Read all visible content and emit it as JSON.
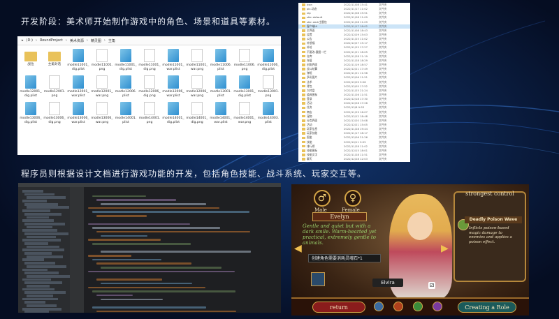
{
  "caption_top": "开发阶段：美术师开始制作游戏中的角色、场景和道具等素材。",
  "caption_mid": "程序员则根据设计文档进行游戏功能的开发，包括角色技能、战斗系统、玩家交互等。",
  "explorer": {
    "breadcrumb": [
      "(D:)",
      "RoundProject",
      "美术资源",
      "精灵图",
      "主角"
    ],
    "files": [
      {
        "name": "战位",
        "kind": "folder"
      },
      {
        "name": "主角对话",
        "kind": "folder"
      },
      {
        "name": "modle11001_dig.plist",
        "kind": "plist"
      },
      {
        "name": "modle11001.png",
        "kind": "png"
      },
      {
        "name": "modle11001_dig.plist",
        "kind": "plist"
      },
      {
        "name": "modle11001_dig.png",
        "kind": "png"
      },
      {
        "name": "modle11001_war.plist",
        "kind": "plist"
      },
      {
        "name": "modle11001_war.png",
        "kind": "png"
      },
      {
        "name": "modle11006.plist",
        "kind": "plist"
      },
      {
        "name": "modle11006.png",
        "kind": "png"
      },
      {
        "name": "modle11006_dig.plist",
        "kind": "plist"
      },
      {
        "name": "modle12001_dig.plist",
        "kind": "plist"
      },
      {
        "name": "modle12001.png",
        "kind": "png"
      },
      {
        "name": "modle12001_war.plist",
        "kind": "plist"
      },
      {
        "name": "modle12001_war.png",
        "kind": "png"
      },
      {
        "name": "modle12006.plist",
        "kind": "plist"
      },
      {
        "name": "modle12006_dig.png",
        "kind": "png"
      },
      {
        "name": "modle12006_war.plist",
        "kind": "plist"
      },
      {
        "name": "modle12006_war.png",
        "kind": "png"
      },
      {
        "name": "modle13001.plist",
        "kind": "plist"
      },
      {
        "name": "modle13001_dig.plist",
        "kind": "plist"
      },
      {
        "name": "modle13001.png",
        "kind": "png"
      },
      {
        "name": "modle13006_dig.plist",
        "kind": "plist"
      },
      {
        "name": "modle13006_dig.png",
        "kind": "png"
      },
      {
        "name": "modle13006_war.plist",
        "kind": "plist"
      },
      {
        "name": "modle13006_war.png",
        "kind": "png"
      },
      {
        "name": "modle14001.plist",
        "kind": "plist"
      },
      {
        "name": "modle14001.png",
        "kind": "png"
      },
      {
        "name": "modle14001_dig.plist",
        "kind": "plist"
      },
      {
        "name": "modle14001_dig.png",
        "kind": "png"
      },
      {
        "name": "modle14001_war.plist",
        "kind": "plist"
      },
      {
        "name": "modle14001_war.png",
        "kind": "png"
      },
      {
        "name": "modle14003.plist",
        "kind": "plist"
      }
    ]
  },
  "folderlist": {
    "rows": [
      {
        "name": "icon",
        "date": "2022/11/08 15:41",
        "type": "文件夹"
      },
      {
        "name": "pic-动态",
        "date": "2022/11/17 11:02",
        "type": "文件夹"
      },
      {
        "name": "vip",
        "date": "2022/11/08 15:51",
        "type": "文件夹"
      },
      {
        "name": "skin default",
        "date": "2022/11/08 11:09",
        "type": "文件夹"
      },
      {
        "name": "skin dark主题包",
        "date": "2022/11/08 11:09",
        "type": "文件夹"
      },
      {
        "name": "客户端UI",
        "date": "2022/11/17 18:02",
        "type": "文件夹",
        "selected": true
      },
      {
        "name": "主界面",
        "date": "2022/11/08 18:43",
        "type": "文件夹"
      },
      {
        "name": "设置",
        "date": "2022/12/29 15:03",
        "type": "文件夹"
      },
      {
        "name": "公告",
        "date": "2022/11/25 11:02",
        "type": "文件夹"
      },
      {
        "name": "补偿福",
        "date": "2022/12/27 15:17",
        "type": "文件夹"
      },
      {
        "name": "补给",
        "date": "2022/11/25 17:27",
        "type": "文件夹"
      },
      {
        "name": "不要改-截图一栏",
        "date": "2022/11/21 18:05",
        "type": "文件夹"
      },
      {
        "name": "仓库",
        "date": "2022/11/28 11:19",
        "type": "文件夹"
      },
      {
        "name": "充值",
        "date": "2022/11/28 18:29",
        "type": "文件夹"
      },
      {
        "name": "创角界面",
        "date": "2022/11/19 18:57",
        "type": "文件夹"
      },
      {
        "name": "战斗结算",
        "date": "2022/12/21 17:49",
        "type": "文件夹"
      },
      {
        "name": "弹框",
        "date": "2022/11/21 11:56",
        "type": "文件夹"
      },
      {
        "name": "多彩图片",
        "date": "2022/12/06 11:51",
        "type": "文件夹"
      },
      {
        "name": "法术",
        "date": "2022/12/09 9:58",
        "type": "文件夹"
      },
      {
        "name": "背包",
        "date": "2022/12/05 17:52",
        "type": "文件夹"
      },
      {
        "name": "大转盘",
        "date": "2022/11/25 21:24",
        "type": "文件夹"
      },
      {
        "name": "道具图标",
        "date": "2022/11/26 11:51",
        "type": "文件夹"
      },
      {
        "name": "登录",
        "date": "2022/12/18 17:30",
        "type": "文件夹"
      },
      {
        "name": "活动",
        "date": "2022/12/28 17:26",
        "type": "文件夹"
      },
      {
        "name": "任务",
        "date": "2022/12/8 9:53",
        "type": "文件夹"
      },
      {
        "name": "商店",
        "date": "2022/11/29 16:07",
        "type": "文件夹"
      },
      {
        "name": "宠物",
        "date": "2022/12/12 18:48",
        "type": "文件夹"
      },
      {
        "name": "分类界面",
        "date": "2022/12/20 15:08",
        "type": "文件夹"
      },
      {
        "name": "活动",
        "date": "2022/12/21 15:05",
        "type": "文件夹"
      },
      {
        "name": "玩家信息",
        "date": "2022/11/28 19:44",
        "type": "文件夹"
      },
      {
        "name": "玩家技能",
        "date": "2022/11/17 18:17",
        "type": "文件夹"
      },
      {
        "name": "图鉴",
        "date": "2022/12/06 21:26",
        "type": "文件夹"
      },
      {
        "name": "技能",
        "date": "2022/10/11 9:55",
        "type": "文件夹"
      },
      {
        "name": "排行榜",
        "date": "2022/11/28 11:02",
        "type": "文件夹"
      },
      {
        "name": "技能图标",
        "date": "2022/12/15 18:01",
        "type": "文件夹"
      },
      {
        "name": "技能文字",
        "date": "2022/11/28 11:51",
        "type": "文件夹"
      },
      {
        "name": "聊天",
        "date": "2022/12/28 12:03",
        "type": "文件夹"
      }
    ]
  },
  "game": {
    "gender_male_icon": "♂",
    "gender_female_icon": "♀",
    "male_label": "Male",
    "female_label": "Female",
    "character_name": "Evelyn",
    "description": "Gentle and quiet but with a dark smile. Warm-hearted yet practical, extremely gentle to animals.",
    "panel_title": "strongest control",
    "skill_name": "Deadly Poison Wave",
    "skill_desc": "Inflicts poison-based magic damage to enemies and applies a poison effect.",
    "popup_text": "创建角色需要消耗灵魂石*1",
    "char_label": "Elvira",
    "dice": "⚂",
    "left_arrow": "◀",
    "right_arrow": "▶",
    "return_label": "return",
    "create_label": "Creating a Role"
  }
}
